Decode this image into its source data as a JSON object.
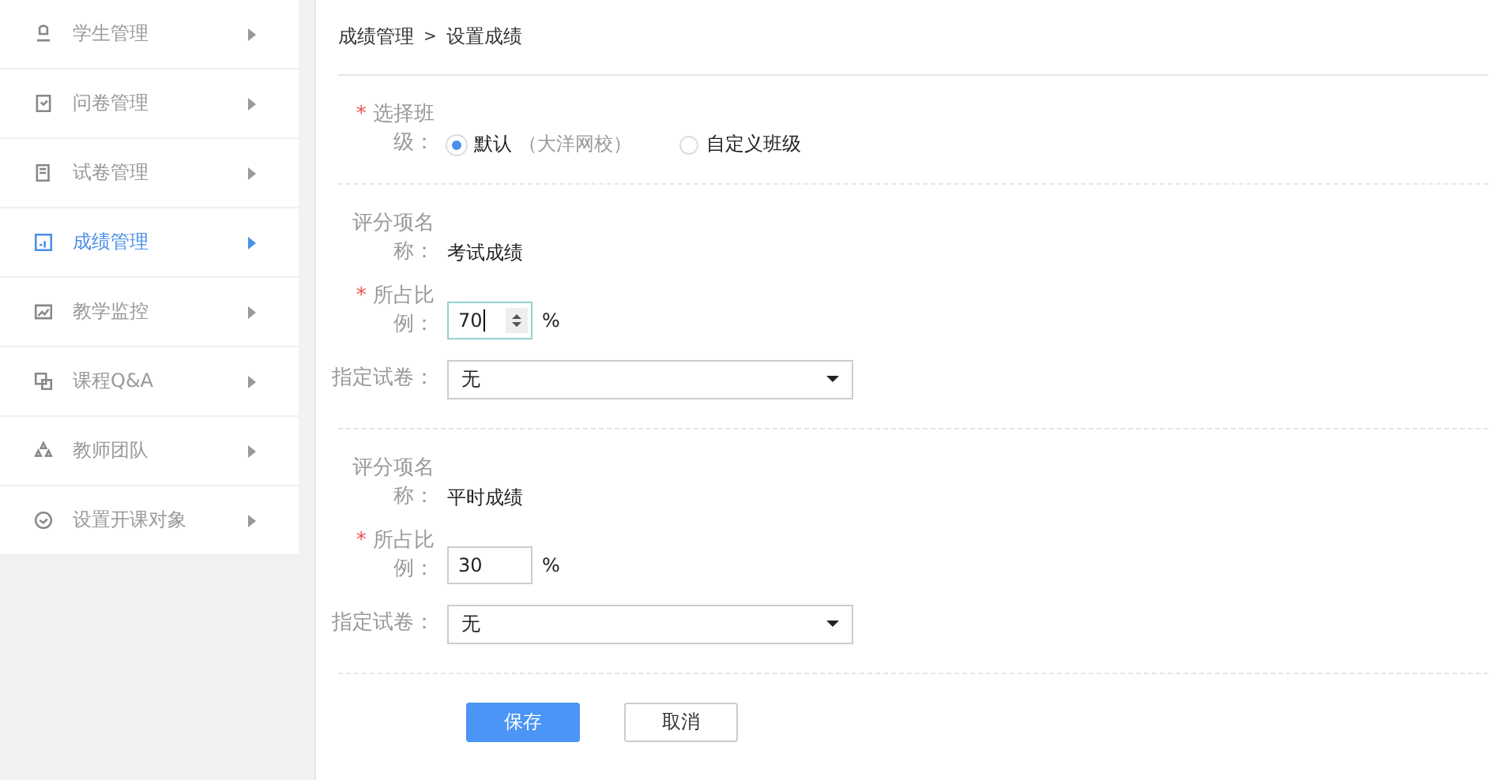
{
  "sidebar": {
    "items": [
      {
        "label": "学生管理",
        "selected": false
      },
      {
        "label": "问卷管理",
        "selected": false
      },
      {
        "label": "试卷管理",
        "selected": false
      },
      {
        "label": "成绩管理",
        "selected": true
      },
      {
        "label": "教学监控",
        "selected": false
      },
      {
        "label": "课程Q&A",
        "selected": false
      },
      {
        "label": "教师团队",
        "selected": false
      },
      {
        "label": "设置开课对象",
        "selected": false
      }
    ]
  },
  "breadcrumb": {
    "items": [
      "成绩管理",
      "设置成绩"
    ],
    "separator": ">"
  },
  "class_choice": {
    "required_mark": "*",
    "label": "选择班级：",
    "options": [
      {
        "label": "默认",
        "note": "（大洋网校）",
        "selected": true
      },
      {
        "label": "自定义班级",
        "selected": false
      }
    ]
  },
  "score_items": [
    {
      "name_label": "评分项名称：",
      "name": "考试成绩",
      "ratio_required_mark": "*",
      "ratio_label": "所占比例：",
      "ratio": "70",
      "unit": "%",
      "focused": true,
      "paper_label": "指定试卷：",
      "paper": "无"
    },
    {
      "name_label": "评分项名称：",
      "name": "平时成绩",
      "ratio_required_mark": "*",
      "ratio_label": "所占比例：",
      "ratio": "30",
      "unit": "%",
      "focused": false,
      "paper_label": "指定试卷：",
      "paper": "无"
    }
  ],
  "buttons": {
    "save": "保存",
    "cancel": "取消"
  }
}
